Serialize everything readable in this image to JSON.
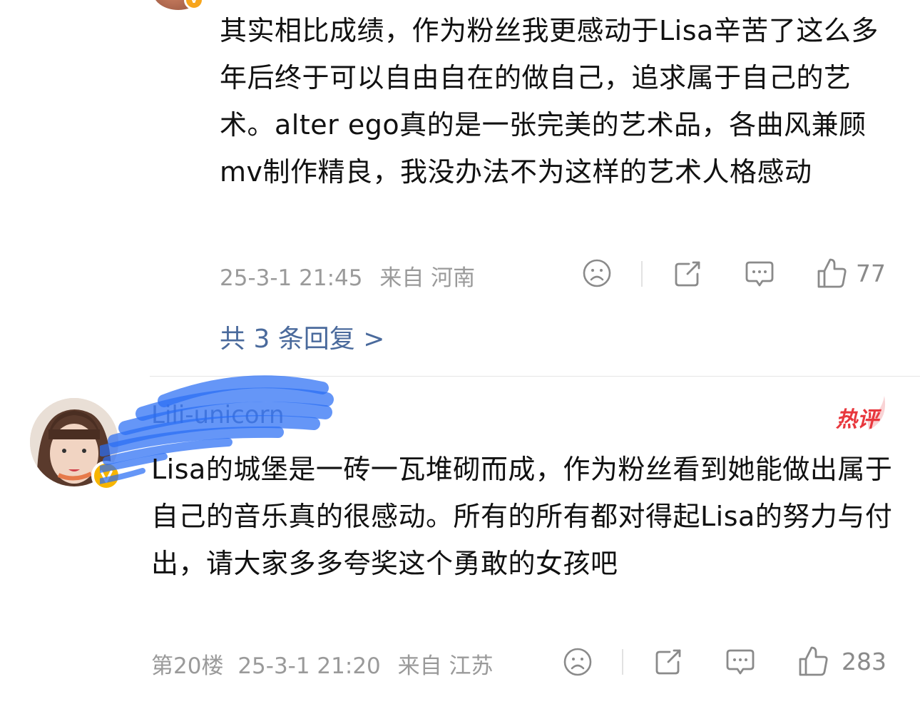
{
  "comment_1": {
    "body": "其实相比成绩，作为粉丝我更感动于Lisa辛苦了这么多年后终于可以自由自在的做自己，追求属于自己的艺术。alter ego真的是一张完美的艺术品，各曲风兼顾mv制作精良，我没办法不为这样的艺术人格感动",
    "timestamp": "25-3-1 21:45",
    "location": "来自 河南",
    "likes": "77",
    "replies_link": "共 3 条回复 >"
  },
  "comment_2": {
    "username": "Lili-unicorn",
    "badge": "热评",
    "body": "Lisa的城堡是一砖一瓦堆砌而成，作为粉丝看到她能做出属于自己的音乐真的很感动。所有的所有都对得起Lisa的努力与付出，请大家多多夸奖这个勇敢的女孩吧",
    "floor": "第20楼",
    "timestamp": "25-3-1 21:20",
    "location": "来自 江苏",
    "likes": "283"
  },
  "icons": [
    "sad-face-icon",
    "share-icon",
    "comment-icon",
    "thumbs-up-icon",
    "verified-badge-icon"
  ],
  "colors": {
    "link": "#4a6a9c",
    "meta": "#9a9a9a",
    "hot": "#e8373d",
    "verified": "#f7b500"
  }
}
